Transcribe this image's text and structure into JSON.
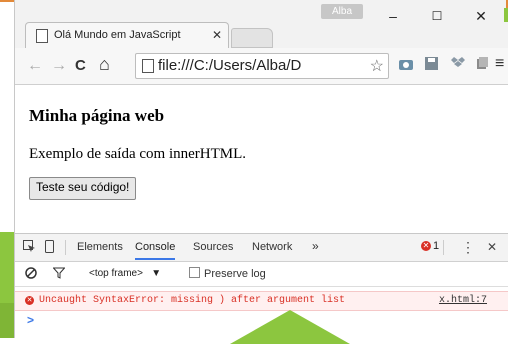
{
  "window": {
    "profile_name": "Alba",
    "minimize_glyph": "–",
    "maximize_glyph": "☐",
    "close_glyph": "✕"
  },
  "tab": {
    "title": "Olá Mundo em JavaScript",
    "close_glyph": "✕"
  },
  "toolbar": {
    "back_icon": "←",
    "forward_icon": "→",
    "reload_icon": "C",
    "home_icon": "⌂",
    "url": "file:///C:/Users/Alba/D",
    "star_icon": "☆",
    "menu_icon": "≡"
  },
  "page": {
    "heading": "Minha página web",
    "paragraph": "Exemplo de saída com innerHTML.",
    "button_label": "Teste seu código!"
  },
  "devtools": {
    "tabs": [
      "Elements",
      "Console",
      "Sources",
      "Network"
    ],
    "more_glyph": "»",
    "active_tab": "Console",
    "error_count": "1",
    "frame_select": "<top frame>",
    "frame_arrow": "▼",
    "preserve_log_label": "Preserve log",
    "error_message": "Uncaught SyntaxError: missing ) after argument list",
    "error_source": "x.html:7",
    "prompt_glyph": ">",
    "kebab_glyph": "⋮",
    "close_glyph": "✕"
  },
  "colors": {
    "error": "#d93025",
    "active_tab_underline": "#3b78e7",
    "accent_green": "#8cc63f",
    "accent_orange": "#e38a3a"
  }
}
